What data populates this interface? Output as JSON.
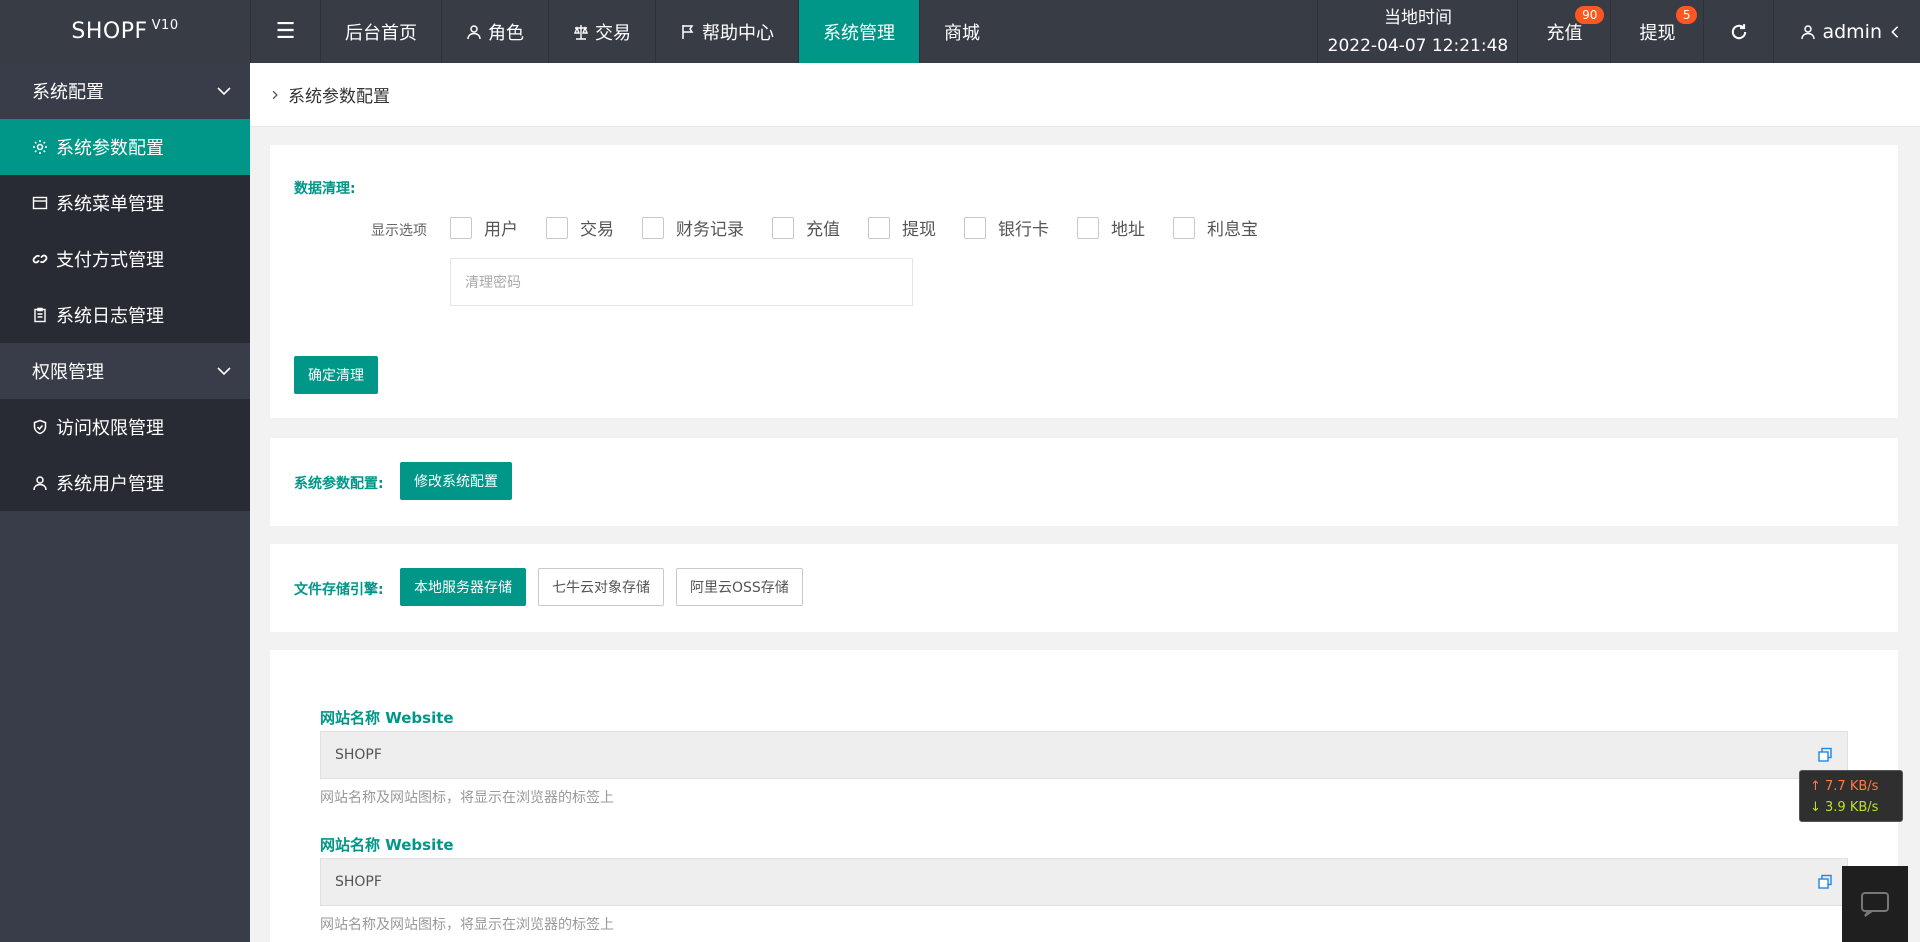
{
  "header": {
    "logo": "SHOPF",
    "logo_version": "V10",
    "nav": [
      {
        "label": "后台首页"
      },
      {
        "label": "角色"
      },
      {
        "label": "交易"
      },
      {
        "label": "帮助中心"
      },
      {
        "label": "系统管理"
      },
      {
        "label": "商城"
      }
    ],
    "clock_title": "当地时间",
    "clock_value": "2022-04-07 12:21:48",
    "recharge_label": "充值",
    "recharge_badge": "90",
    "withdraw_label": "提现",
    "withdraw_badge": "5",
    "user_label": "admin"
  },
  "sidebar": {
    "groups": [
      {
        "title": "系统配置",
        "items": [
          {
            "label": "系统参数配置"
          },
          {
            "label": "系统菜单管理"
          },
          {
            "label": "支付方式管理"
          },
          {
            "label": "系统日志管理"
          }
        ]
      },
      {
        "title": "权限管理",
        "items": [
          {
            "label": "访问权限管理"
          },
          {
            "label": "系统用户管理"
          }
        ]
      }
    ]
  },
  "breadcrumb": "系统参数配置",
  "data_clean": {
    "title": "数据清理:",
    "options_label": "显示选项",
    "options": [
      "用户",
      "交易",
      "财务记录",
      "充值",
      "提现",
      "银行卡",
      "地址",
      "利息宝"
    ],
    "password_placeholder": "清理密码",
    "confirm_button": "确定清理"
  },
  "sys_params": {
    "label": "系统参数配置:",
    "button": "修改系统配置"
  },
  "storage": {
    "label": "文件存储引擎:",
    "options": [
      "本地服务器存储",
      "七牛云对象存储",
      "阿里云OSS存储"
    ]
  },
  "fields": [
    {
      "label": "网站名称 Website",
      "value": "SHOPF",
      "hint": "网站名称及网站图标，将显示在浏览器的标签上"
    },
    {
      "label": "网站名称 Website",
      "value": "SHOPF",
      "hint": "网站名称及网站图标，将显示在浏览器的标签上"
    }
  ],
  "speed_widget": {
    "up": "↑ 7.7 KB/s",
    "down": "↓ 3.9 KB/s"
  },
  "colors": {
    "accent": "#009688",
    "header_bg": "#383c45",
    "sidebar_bg": "#393d49",
    "badge": "#ff5722"
  }
}
